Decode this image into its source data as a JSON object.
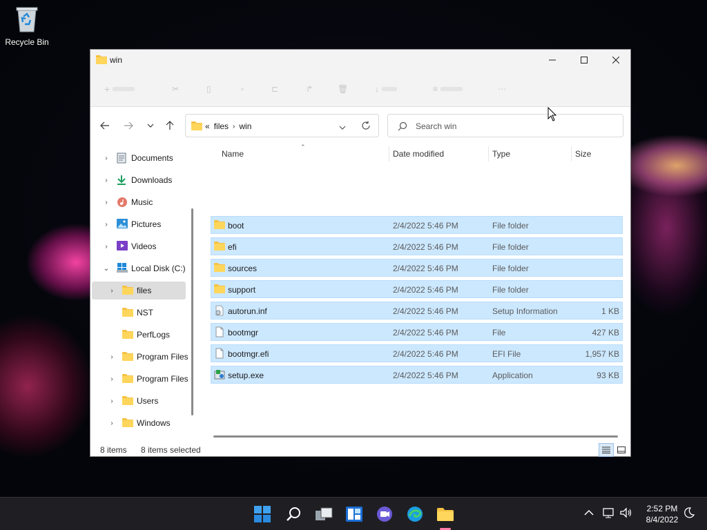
{
  "desktop": {
    "recycle_bin_label": "Recycle Bin"
  },
  "window": {
    "title": "win",
    "controls": [
      "minimize",
      "maximize",
      "close"
    ]
  },
  "address": {
    "overflow": "«",
    "crumbs": [
      "files",
      "win"
    ],
    "search_placeholder": "Search win"
  },
  "sidebar": {
    "items": [
      {
        "label": "Documents",
        "icon": "documents-icon",
        "expanded": false
      },
      {
        "label": "Downloads",
        "icon": "downloads-icon",
        "expanded": false
      },
      {
        "label": "Music",
        "icon": "music-icon",
        "expanded": false
      },
      {
        "label": "Pictures",
        "icon": "pictures-icon",
        "expanded": false
      },
      {
        "label": "Videos",
        "icon": "videos-icon",
        "expanded": false
      },
      {
        "label": "Local Disk (C:)",
        "icon": "drive-icon",
        "expanded": true
      },
      {
        "label": "files",
        "icon": "folder-icon",
        "selected": true
      },
      {
        "label": "NST",
        "icon": "folder-icon"
      },
      {
        "label": "PerfLogs",
        "icon": "folder-icon"
      },
      {
        "label": "Program Files",
        "icon": "folder-icon"
      },
      {
        "label": "Program Files",
        "icon": "folder-icon"
      },
      {
        "label": "Users",
        "icon": "folder-icon"
      },
      {
        "label": "Windows",
        "icon": "folder-icon"
      }
    ]
  },
  "table": {
    "columns": [
      "Name",
      "Date modified",
      "Type",
      "Size"
    ],
    "rows": [
      {
        "name": "boot",
        "date": "2/4/2022 5:46 PM",
        "type": "File folder",
        "size": "",
        "icon": "folder-icon"
      },
      {
        "name": "efi",
        "date": "2/4/2022 5:46 PM",
        "type": "File folder",
        "size": "",
        "icon": "folder-icon"
      },
      {
        "name": "sources",
        "date": "2/4/2022 5:46 PM",
        "type": "File folder",
        "size": "",
        "icon": "folder-icon"
      },
      {
        "name": "support",
        "date": "2/4/2022 5:46 PM",
        "type": "File folder",
        "size": "",
        "icon": "folder-icon"
      },
      {
        "name": "autorun.inf",
        "date": "2/4/2022 5:46 PM",
        "type": "Setup Information",
        "size": "1 KB",
        "icon": "setup-info-icon"
      },
      {
        "name": "bootmgr",
        "date": "2/4/2022 5:46 PM",
        "type": "File",
        "size": "427 KB",
        "icon": "file-icon"
      },
      {
        "name": "bootmgr.efi",
        "date": "2/4/2022 5:46 PM",
        "type": "EFI File",
        "size": "1,957 KB",
        "icon": "file-icon"
      },
      {
        "name": "setup.exe",
        "date": "2/4/2022 5:46 PM",
        "type": "Application",
        "size": "93 KB",
        "icon": "setup-exe-icon"
      }
    ]
  },
  "status": {
    "item_count": "8 items",
    "selected_count": "8 items selected"
  },
  "taskbar": {
    "time": "2:52 PM",
    "date": "8/4/2022"
  },
  "colors": {
    "selection": "#cce8ff",
    "folder": "#f6c243",
    "accent": "#0078d4"
  }
}
